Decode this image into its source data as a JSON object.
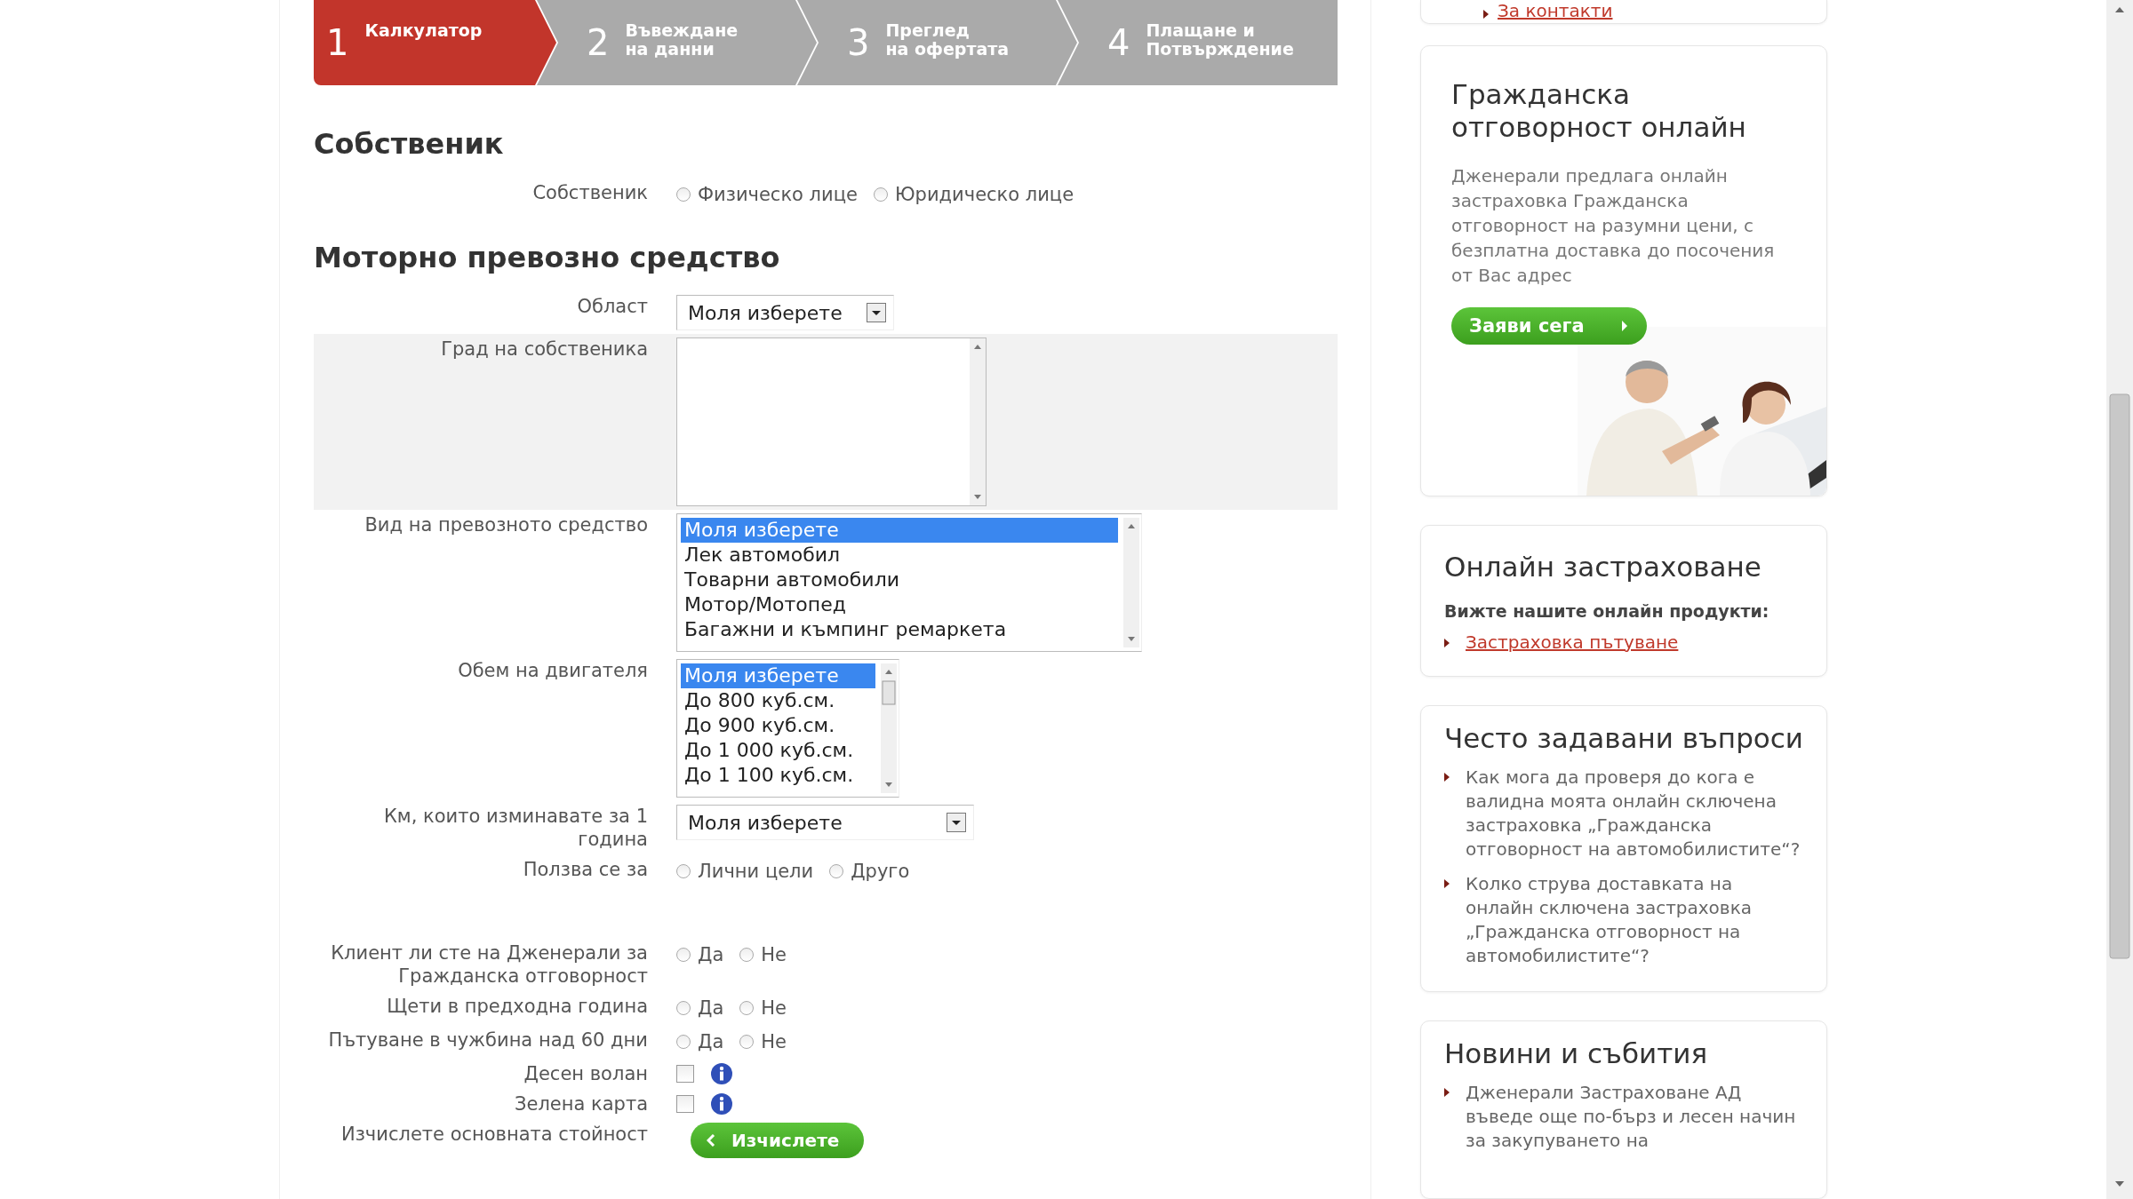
{
  "steps": [
    {
      "number": "1",
      "lines": [
        "Калкулатор"
      ],
      "selected": true
    },
    {
      "number": "2",
      "lines": [
        "Въвеждане",
        "на данни"
      ],
      "selected": false
    },
    {
      "number": "3",
      "lines": [
        "Преглед",
        "на офертата"
      ],
      "selected": false
    },
    {
      "number": "4",
      "lines": [
        "Плащане и",
        "Потвърждение"
      ],
      "selected": false
    }
  ],
  "sections": [
    {
      "heading": "Собственик",
      "fields": [
        {
          "kind": "radio",
          "label": "Собственик",
          "options": [
            {
              "label": "Физическо лице",
              "selected": false
            },
            {
              "label": "Юридическо лице",
              "selected": false
            }
          ]
        }
      ]
    },
    {
      "heading": "Моторно превозно средство",
      "fields": [
        {
          "kind": "dropdown",
          "label": "Област",
          "value": "Моля изберете"
        },
        {
          "kind": "textarea",
          "label": "Град на собственика",
          "highlighted": true
        },
        {
          "kind": "listbox",
          "label": "Вид на превозното средство",
          "options": [
            {
              "label": "Моля изберете",
              "selected": true
            },
            {
              "label": "Лек автомобил",
              "selected": false
            },
            {
              "label": "Товарни автомобили",
              "selected": false
            },
            {
              "label": "Мотор/Мотопед",
              "selected": false
            },
            {
              "label": "Багажни и къмпинг ремаркета",
              "selected": false
            }
          ]
        },
        {
          "kind": "listbox",
          "label": "Обем на двигателя",
          "options": [
            {
              "label": "Моля изберете",
              "selected": true
            },
            {
              "label": "До 800 куб.см.",
              "selected": false
            },
            {
              "label": "До 900 куб.см.",
              "selected": false
            },
            {
              "label": "До 1 000 куб.см.",
              "selected": false
            },
            {
              "label": "До 1 100 куб.см.",
              "selected": false
            }
          ]
        },
        {
          "kind": "dropdown",
          "label": "Км, които изминавате за 1 година",
          "value": "Моля изберете"
        },
        {
          "kind": "radio",
          "label": "Ползва се за",
          "options": [
            {
              "label": "Лични цели",
              "selected": false
            },
            {
              "label": "Друго",
              "selected": false
            }
          ]
        }
      ]
    },
    {
      "fields": [
        {
          "kind": "radio",
          "label": "Клиент ли сте на Дженерали за Гражданска отговорност",
          "options": [
            {
              "label": "Да",
              "selected": false
            },
            {
              "label": "Не",
              "selected": false
            }
          ]
        },
        {
          "kind": "radio",
          "label": "Щети в предходна година",
          "options": [
            {
              "label": "Да",
              "selected": false
            },
            {
              "label": "Не",
              "selected": false
            }
          ]
        },
        {
          "kind": "radio",
          "label": "Пътуване в чужбина над 60 дни",
          "options": [
            {
              "label": "Да",
              "selected": false
            },
            {
              "label": "Не",
              "selected": false
            }
          ]
        },
        {
          "kind": "checkbox",
          "label": "Десен волан",
          "checked": false
        },
        {
          "kind": "checkbox",
          "label": "Зелена карта",
          "checked": false
        },
        {
          "kind": "button",
          "label": "Изчислете основната стойност",
          "button": "Изчислете"
        }
      ]
    }
  ],
  "sidebar": {
    "top_link": "За контакти",
    "cards": [
      {
        "kind": "promo",
        "title": "Гражданска отговорност онлайн",
        "text": "Дженерали предлага онлайн застраховка Гражданска отговорност на разумни цени, с безплатна доставка до посочения от Вас адрес",
        "button": "Заяви сега"
      },
      {
        "kind": "links",
        "title": "Онлайн застраховане",
        "subtitle": "Вижте нашите онлайн продукти:",
        "links": [
          "Застраховка пътуване"
        ]
      },
      {
        "kind": "list",
        "title": "Често задавани въпроси",
        "items": [
          "Как мога да проверя до кога е валидна моята онлайн сключена застраховка „Гражданска отговорност на автомобилистите“?",
          "Колко струва доставката на онлайн сключена застраховка „Гражданска отговорност на автомобилистите“?"
        ]
      },
      {
        "kind": "list",
        "title": "Новини и събития",
        "items": [
          "Дженерали Застраховане АД въведе още по-бърз и лесен начин за закупуването на"
        ]
      }
    ]
  }
}
